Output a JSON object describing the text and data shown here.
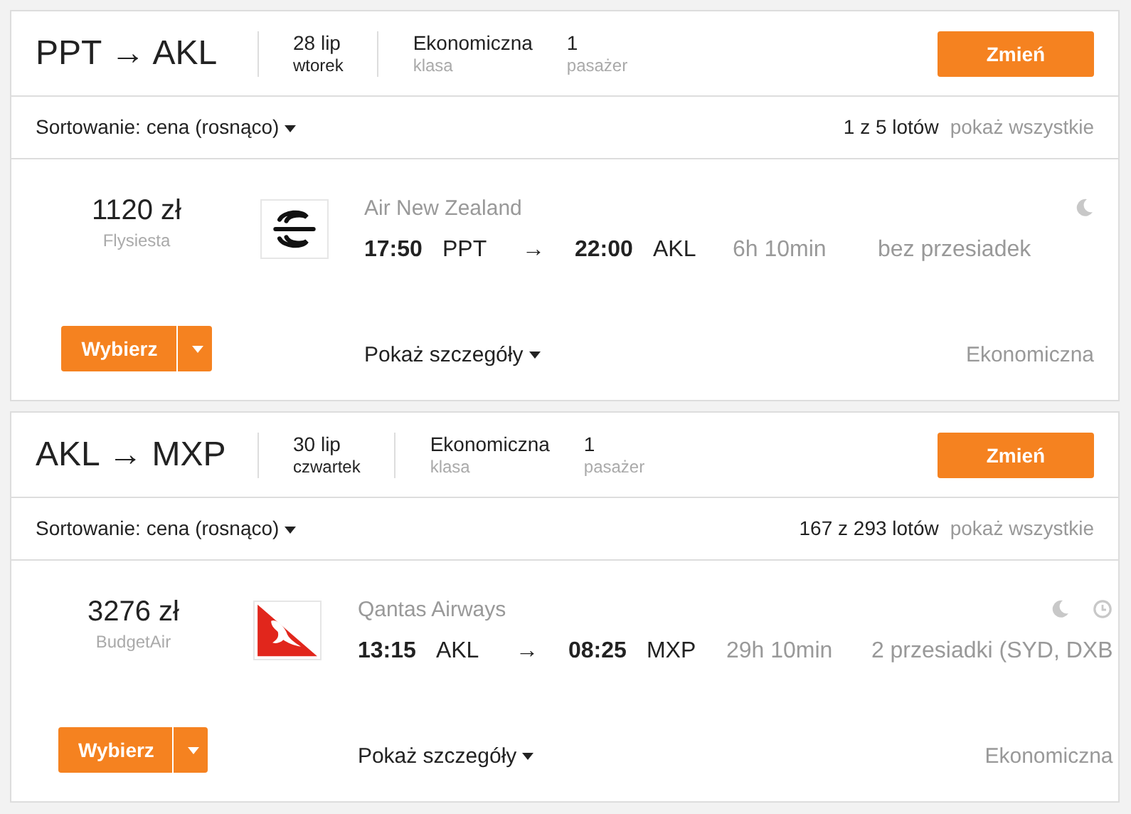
{
  "segments": [
    {
      "route": {
        "from": "PPT",
        "arrow": "→",
        "to": "AKL"
      },
      "date": "28 lip",
      "weekday": "wtorek",
      "cabin": "Ekonomiczna",
      "cabin_label": "klasa",
      "passengers": "1",
      "passengers_label": "pasażer",
      "change_button": "Zmień",
      "sort": "Sortowanie: cena (rosnąco)",
      "count": "1 z 5 lotów",
      "show_all": "pokaż wszystkie",
      "flights": [
        {
          "price": "1120 zł",
          "provider": "Flysiesta",
          "select_button": "Wybierz",
          "logo": {
            "kind": "fern"
          },
          "airline": "Air New Zealand",
          "icons": [
            {
              "kind": "moon"
            }
          ],
          "departure_time": "17:50",
          "departure_code": "PPT",
          "arrow": "→",
          "arrival_time": "22:00",
          "arrival_code": "AKL",
          "duration": "6h 10min",
          "stops": "bez przesiadek",
          "details_link": "Pokaż szczegóły",
          "cabin": "Ekonomiczna"
        }
      ]
    },
    {
      "route": {
        "from": "AKL",
        "arrow": "→",
        "to": "MXP"
      },
      "date": "30 lip",
      "weekday": "czwartek",
      "cabin": "Ekonomiczna",
      "cabin_label": "klasa",
      "passengers": "1",
      "passengers_label": "pasażer",
      "change_button": "Zmień",
      "sort": "Sortowanie: cena (rosnąco)",
      "count": "167 z 293 lotów",
      "show_all": "pokaż wszystkie",
      "flights": [
        {
          "price": "3276 zł",
          "provider": "BudgetAir",
          "select_button": "Wybierz",
          "logo": {
            "kind": "kangaroo"
          },
          "airline": "Qantas Airways",
          "icons": [
            {
              "kind": "moon"
            },
            {
              "kind": "clock"
            }
          ],
          "departure_time": "13:15",
          "departure_code": "AKL",
          "arrow": "→",
          "arrival_time": "08:25",
          "arrival_code": "MXP",
          "duration": "29h 10min",
          "stops": "2 przesiadki (SYD, DXB",
          "details_link": "Pokaż szczegóły",
          "cabin": "Ekonomiczna"
        }
      ]
    }
  ]
}
